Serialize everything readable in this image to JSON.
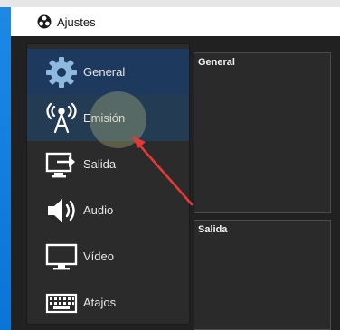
{
  "window": {
    "title": "Ajustes",
    "app_icon": "obs-logo-icon"
  },
  "sidebar": {
    "items": [
      {
        "label": "General",
        "icon": "gear-icon",
        "state": "selected"
      },
      {
        "label": "Emisión",
        "icon": "broadcast-antenna-icon",
        "state": "hovered"
      },
      {
        "label": "Salida",
        "icon": "monitor-output-icon",
        "state": "normal"
      },
      {
        "label": "Audio",
        "icon": "speaker-icon",
        "state": "normal"
      },
      {
        "label": "Vídeo",
        "icon": "monitor-icon",
        "state": "normal"
      },
      {
        "label": "Atajos",
        "icon": "keyboard-icon",
        "state": "normal"
      }
    ]
  },
  "main": {
    "groups": [
      {
        "title": "General"
      },
      {
        "title": "Salida"
      }
    ]
  },
  "colors": {
    "accent_selected": "#1d3a5e",
    "annotation_arrow": "#e53935",
    "panel_background": "#2b2b2b"
  }
}
